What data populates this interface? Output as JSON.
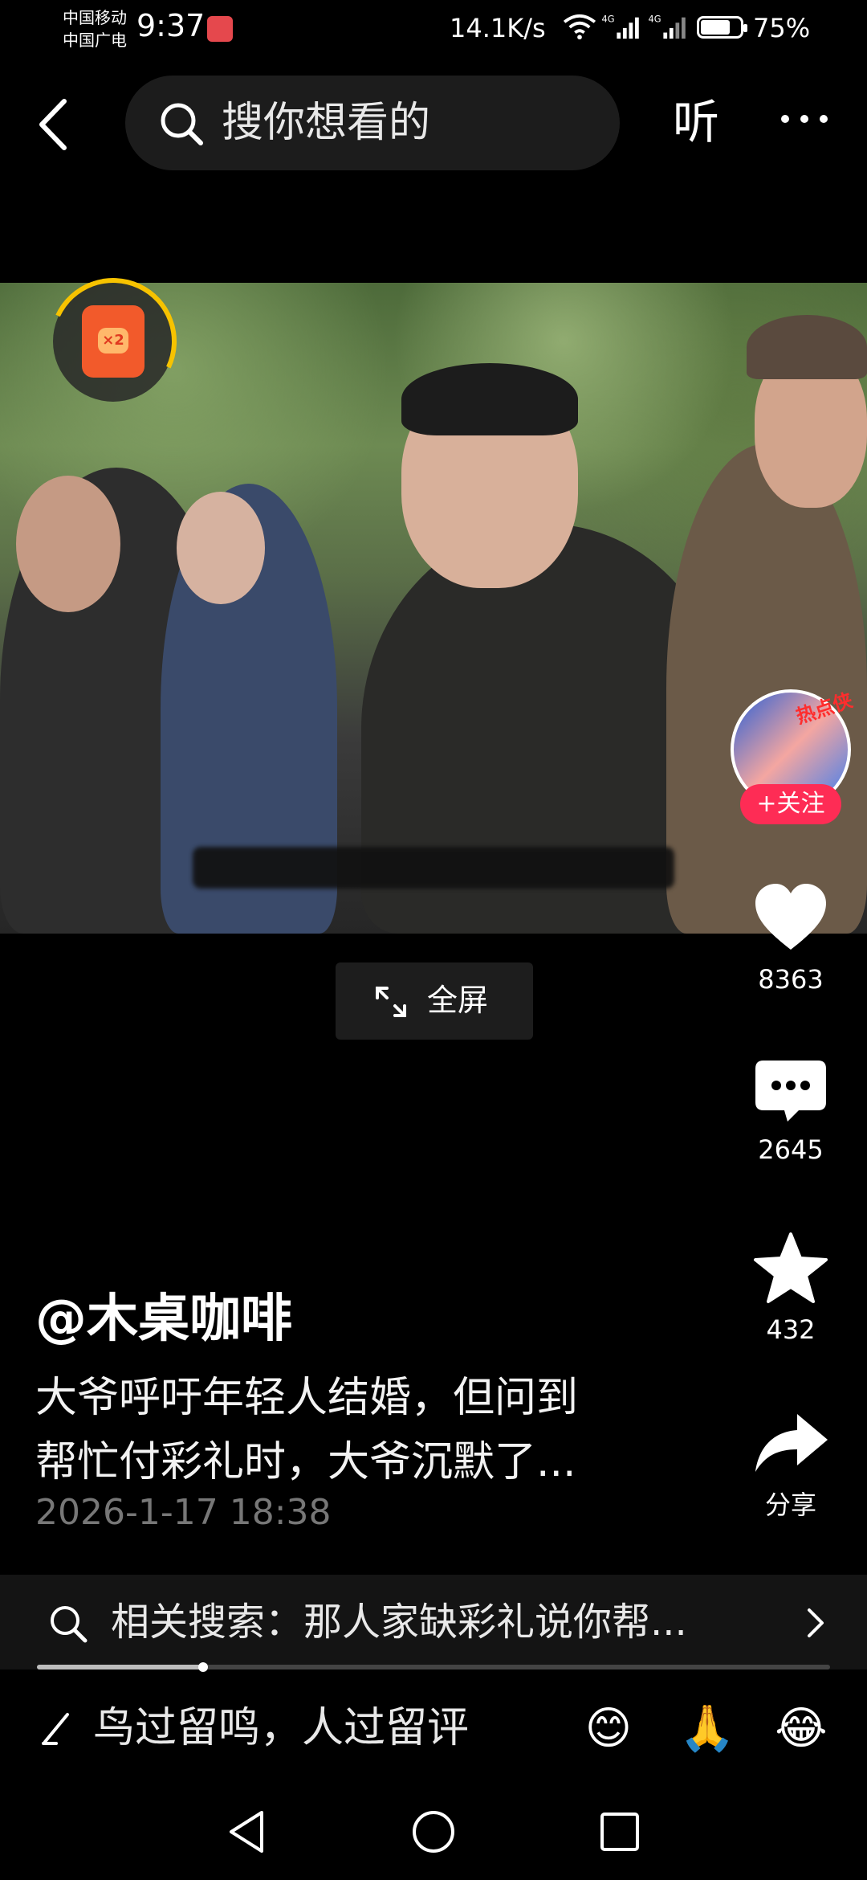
{
  "status_bar": {
    "carrier_1": "中国移动",
    "carrier_2": "中国广电",
    "time": "9:37",
    "net_speed": "14.1K/s",
    "network_1": "4G",
    "network_2": "4G",
    "battery_percent": "75%",
    "battery_level": 0.75
  },
  "nav": {
    "search_placeholder": "搜你想看的",
    "listen_label": "听"
  },
  "video": {
    "fullscreen_label": "全屏"
  },
  "right_rail": {
    "hot_tag": "热点侠",
    "follow_label": "+关注",
    "like_count": "8363",
    "comment_count": "2645",
    "favorite_count": "432",
    "share_label": "分享"
  },
  "post": {
    "author": "@木桌咖啡",
    "description_line1": "大爷呼吁年轻人结婚，但问到",
    "description_line2": "帮忙付彩礼时，大爷沉默了...",
    "timestamp": "2026-1-17 18:38"
  },
  "related_search": {
    "label": "相关搜索：那人家缺彩礼说你帮..."
  },
  "playback": {
    "progress": 0.21
  },
  "comment_bar": {
    "placeholder": "鸟过留鸣，人过留评",
    "emojis": [
      "😊",
      "🙏",
      "😂"
    ]
  },
  "colors": {
    "background": "#000000",
    "follow_red": "#fe2c55",
    "hot_tag_red": "#ff2d2d"
  }
}
